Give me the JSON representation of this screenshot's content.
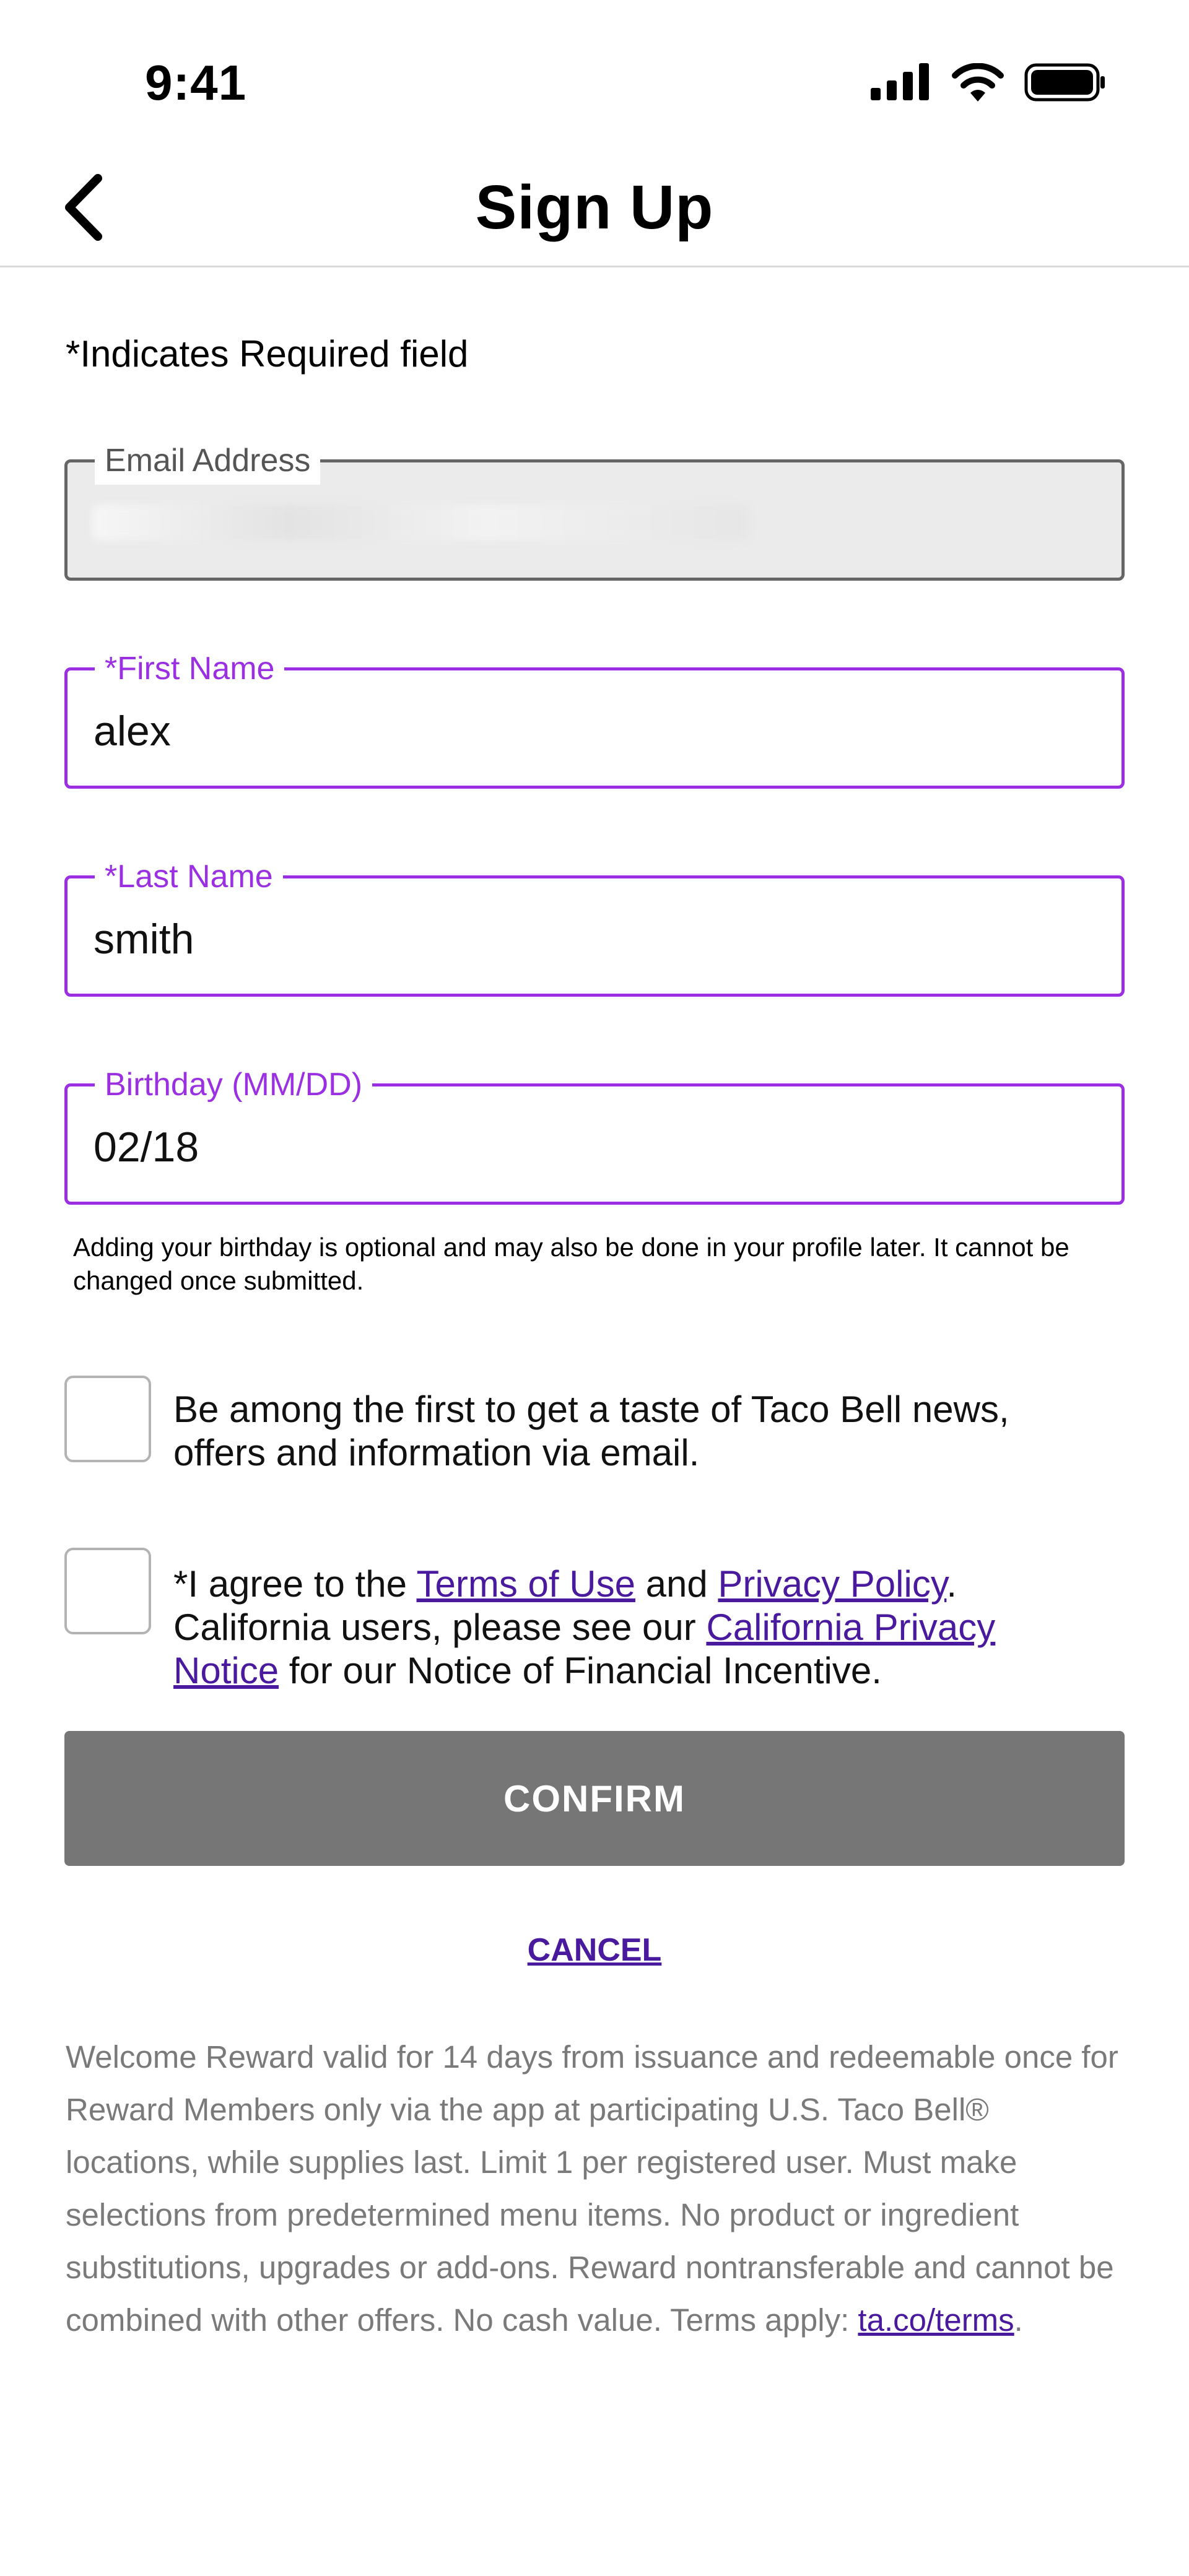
{
  "status_bar": {
    "time": "9:41",
    "icons": [
      "signal-icon",
      "wifi-icon",
      "battery-icon"
    ]
  },
  "nav": {
    "title": "Sign Up",
    "back_icon": "chevron-left-icon"
  },
  "form": {
    "required_note": "*Indicates Required field",
    "email": {
      "label": "Email Address",
      "value": ""
    },
    "first_name": {
      "label": "*First Name",
      "value": "alex"
    },
    "last_name": {
      "label": "*Last Name",
      "value": "smith"
    },
    "birthday": {
      "label": "Birthday (MM/DD)",
      "value": "02/18"
    },
    "birthday_helper": "Adding your birthday is optional and may also be done in your profile later. It cannot be changed once submitted.",
    "news_optin": "Be among the first to get a taste of Taco Bell news, offers and information via email.",
    "agree": {
      "prefix": "*I agree to the ",
      "terms_link": "Terms of Use",
      "and": " and ",
      "privacy_link": "Privacy Policy",
      "middle": ". California users, please see our ",
      "ca_link": "California Privacy Notice",
      "suffix": " for our Notice of Financial Incentive."
    },
    "confirm_label": "CONFIRM",
    "cancel_label": "CANCEL"
  },
  "disclaimer": {
    "text": "Welcome Reward valid for 14 days from issuance and redeemable once for Reward Members only via the app at participating U.S. Taco Bell® locations, while supplies last. Limit 1 per registered user. Must make selections from predetermined menu items. No product or ingredient substitutions, upgrades or add-ons. Reward nontransferable and cannot be combined with other offers. No cash value. Terms apply: ",
    "link": "ta.co/terms",
    "end": "."
  },
  "colors": {
    "accent_purple": "#9b30e3",
    "link_purple": "#4a1a9e",
    "button_gray": "#767676",
    "disclaimer_gray": "#7a7a7a"
  }
}
